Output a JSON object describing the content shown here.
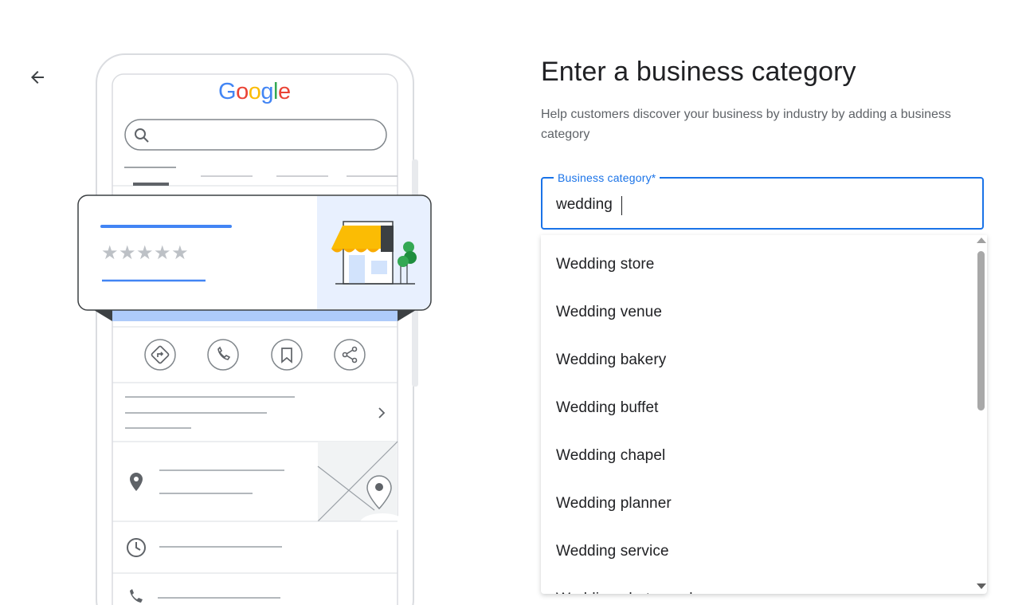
{
  "nav": {
    "back_icon": "arrow-back-icon"
  },
  "illustration": {
    "logo_letters": [
      {
        "char": "G",
        "color": "#4285F4"
      },
      {
        "char": "o",
        "color": "#EA4335"
      },
      {
        "char": "o",
        "color": "#FBBC05"
      },
      {
        "char": "g",
        "color": "#4285F4"
      },
      {
        "char": "l",
        "color": "#34A853"
      },
      {
        "char": "e",
        "color": "#EA4335"
      }
    ],
    "rating_stars": 5,
    "action_icons": [
      "directions-icon",
      "phone-icon",
      "bookmark-icon",
      "share-icon"
    ]
  },
  "form": {
    "title": "Enter a business category",
    "subtitle": "Help customers discover your business by industry by adding a business category",
    "field_label": "Business category*",
    "field_value": "wedding",
    "accent_color": "#1a73e8"
  },
  "suggestions": [
    "Wedding store",
    "Wedding venue",
    "Wedding bakery",
    "Wedding buffet",
    "Wedding chapel",
    "Wedding planner",
    "Wedding service",
    "Wedding photographer"
  ]
}
